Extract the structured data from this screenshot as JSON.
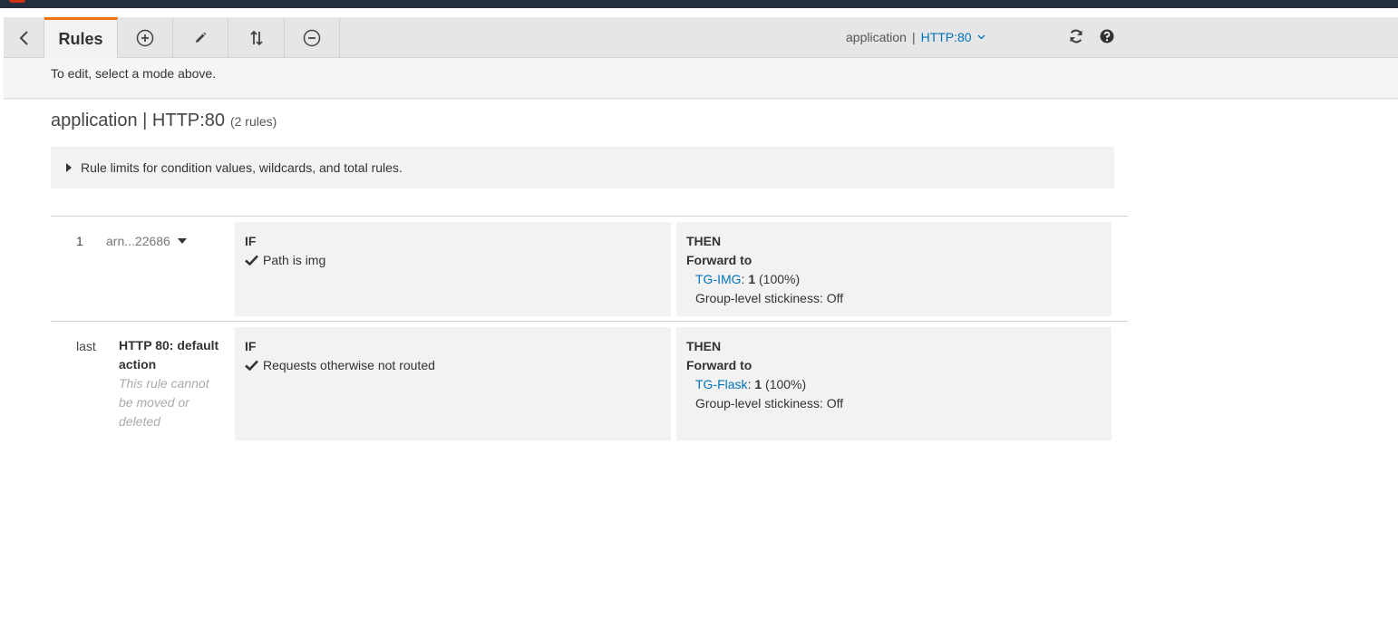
{
  "colors": {
    "header_bg": "#232f3e",
    "accent_tab": "#ec7211",
    "link": "#0073bb",
    "panel_bg": "#f2f2f2",
    "toolbar_bg": "#e6e6e6"
  },
  "toolbar": {
    "back_icon": "chevron-left-icon",
    "active_tab": "Rules",
    "mode_icons": [
      "plus-circle-icon",
      "pencil-icon",
      "reorder-arrows-icon",
      "minus-circle-icon"
    ],
    "listener_prefix": "application",
    "listener_sep": "|",
    "listener_value": "HTTP:80",
    "refresh_icon": "refresh-icon",
    "help_icon": "question-circle-icon"
  },
  "info_bar": {
    "text": "To edit, select a mode above."
  },
  "page": {
    "title": "application | HTTP:80",
    "rule_count": "(2 rules)",
    "limits_text": "Rule limits for condition values, wildcards, and total rules."
  },
  "rules": [
    {
      "number": "1",
      "arn": "arn...22686",
      "if_label": "IF",
      "condition": "Path is img",
      "then_label": "THEN",
      "action": "Forward to",
      "target_group": "TG-IMG",
      "weight": "1",
      "percent": "(100%)",
      "stickiness": "Group-level stickiness: Off"
    },
    {
      "number": "last",
      "title": "HTTP 80: default action",
      "note": "This rule cannot be moved or deleted",
      "if_label": "IF",
      "condition": "Requests otherwise not routed",
      "then_label": "THEN",
      "action": "Forward to",
      "target_group": "TG-Flask",
      "weight": "1",
      "percent": "(100%)",
      "stickiness": "Group-level stickiness: Off"
    }
  ]
}
